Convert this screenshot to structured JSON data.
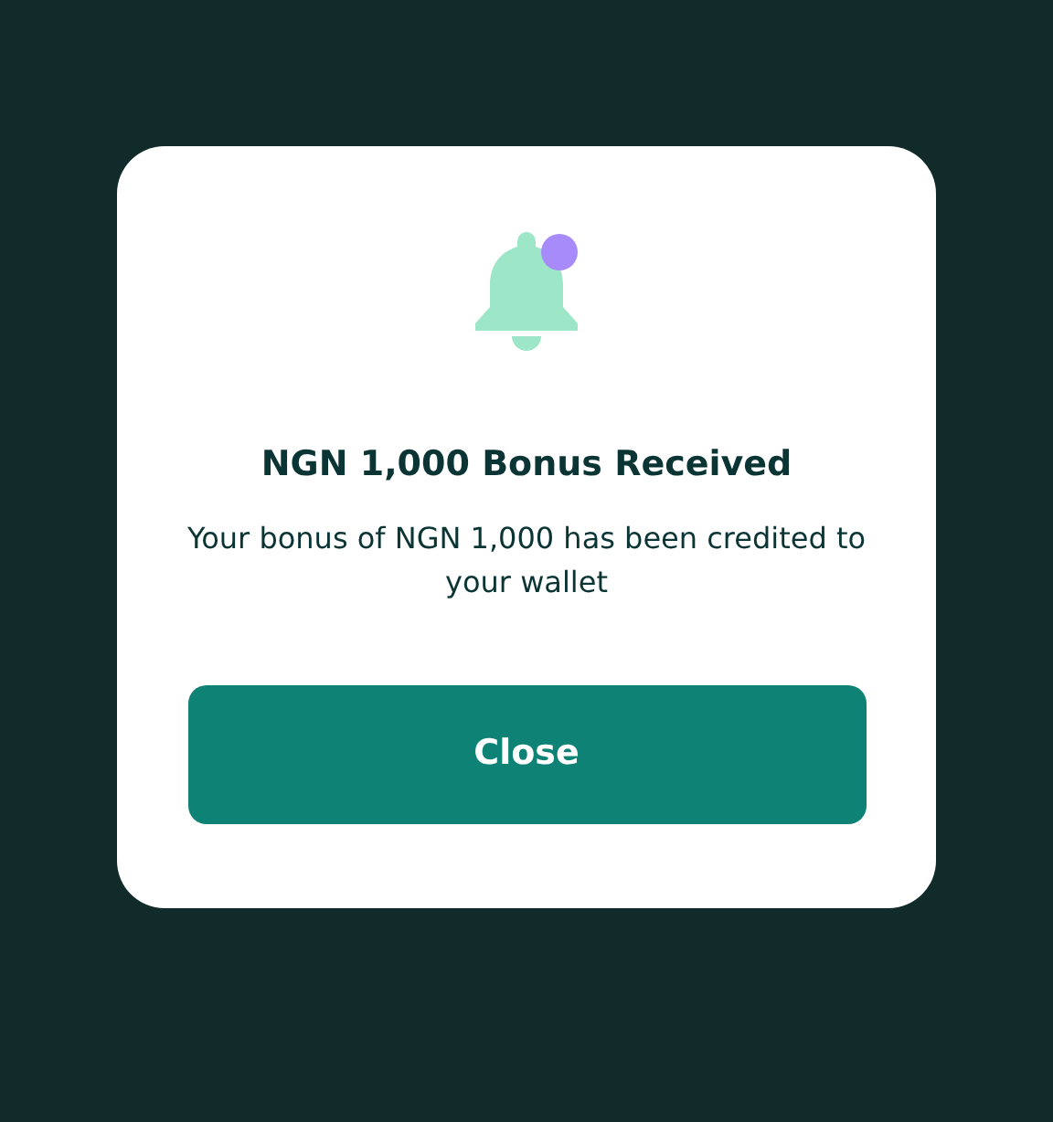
{
  "dialog": {
    "title": "NGN 1,000 Bonus Received",
    "message": "Your bonus of NGN 1,000 has been credited to your wallet",
    "notification_dot": true,
    "button": "Close"
  }
}
